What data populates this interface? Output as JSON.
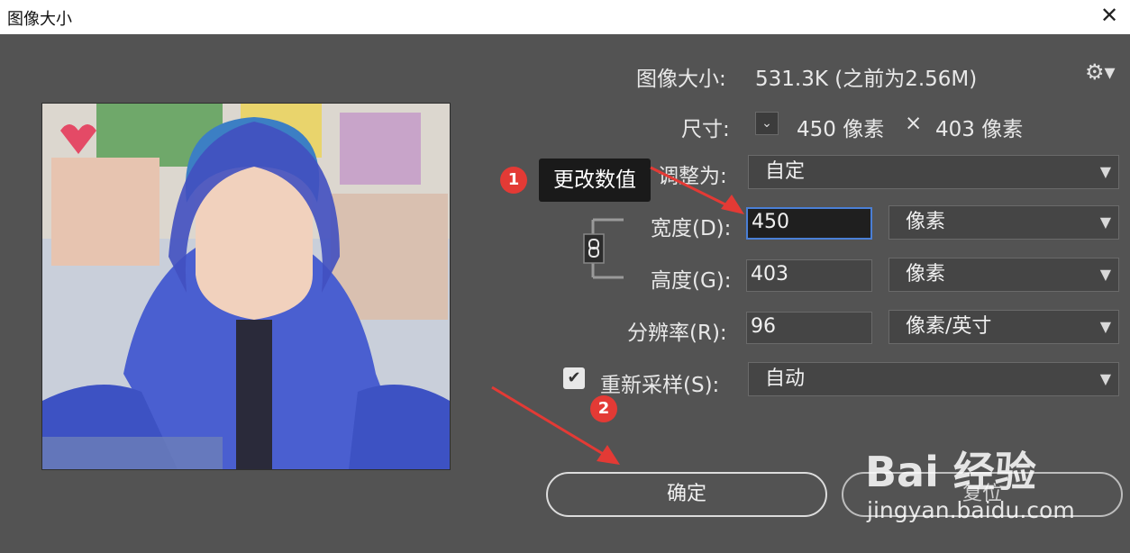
{
  "window": {
    "title": "图像大小"
  },
  "info": {
    "size_label": "图像大小:",
    "size_value": "531.3K (之前为2.56M)",
    "dimensions_label": "尺寸:",
    "width_px": "450 像素",
    "times": "×",
    "height_px": "403 像素"
  },
  "form": {
    "fit_label": "调整为:",
    "fit_value": "自定",
    "width_label": "宽度(D):",
    "width_value": "450",
    "width_unit": "像素",
    "height_label": "高度(G):",
    "height_value": "403",
    "height_unit": "像素",
    "resolution_label": "分辨率(R):",
    "resolution_value": "96",
    "resolution_unit": "像素/英寸",
    "resample_label": "重新采样(S):",
    "resample_value": "自动",
    "resample_checked": true
  },
  "buttons": {
    "ok": "确定",
    "reset": "复位"
  },
  "annotations": {
    "tooltip": "更改数值",
    "badge1": "1",
    "badge2": "2",
    "color": "#e33a35"
  },
  "watermark": {
    "logo": "Bai 经验",
    "url": "jingyan.baidu.com"
  },
  "icons": {
    "close": "close-icon",
    "gear": "gear-icon",
    "chain": "chain-link-icon",
    "chevron": "chevron-down-icon",
    "check": "checkmark-icon"
  }
}
